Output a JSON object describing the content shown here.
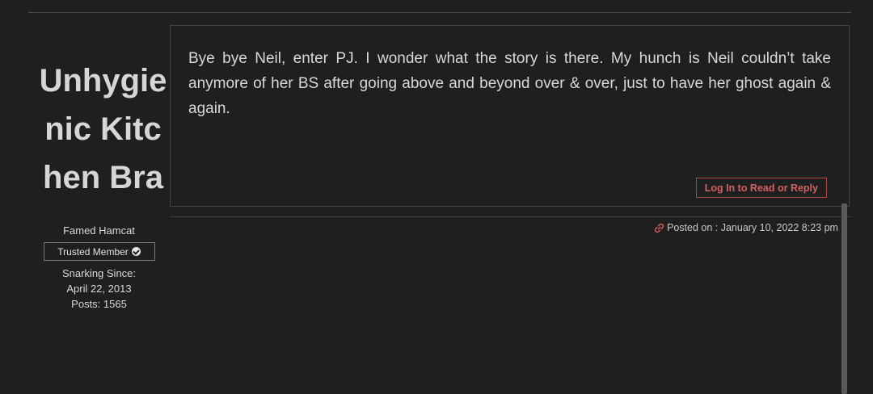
{
  "author": {
    "name": "Unhygienic Kitchen Bra",
    "rank": "Famed Hamcat",
    "badge_label": "Trusted Member",
    "joined_label": "Snarking Since:",
    "joined_date": "April 22, 2013",
    "posts_label": "Posts: 1565"
  },
  "post": {
    "body": "Bye bye Neil, enter PJ. I wonder what the story is there. My hunch is Neil couldn’t take anymore of her BS after going above and beyond over & over, just to have her ghost again & again.",
    "reply_button_label": "Log In to Read or Reply",
    "posted_on": "Posted on : January 10, 2022 8:23 pm"
  },
  "icons": {
    "badge": "check-circle-icon",
    "posted": "link-icon"
  },
  "colors": {
    "background": "#1f1f1f",
    "accent": "#d46060",
    "text": "#d8d8d8"
  }
}
